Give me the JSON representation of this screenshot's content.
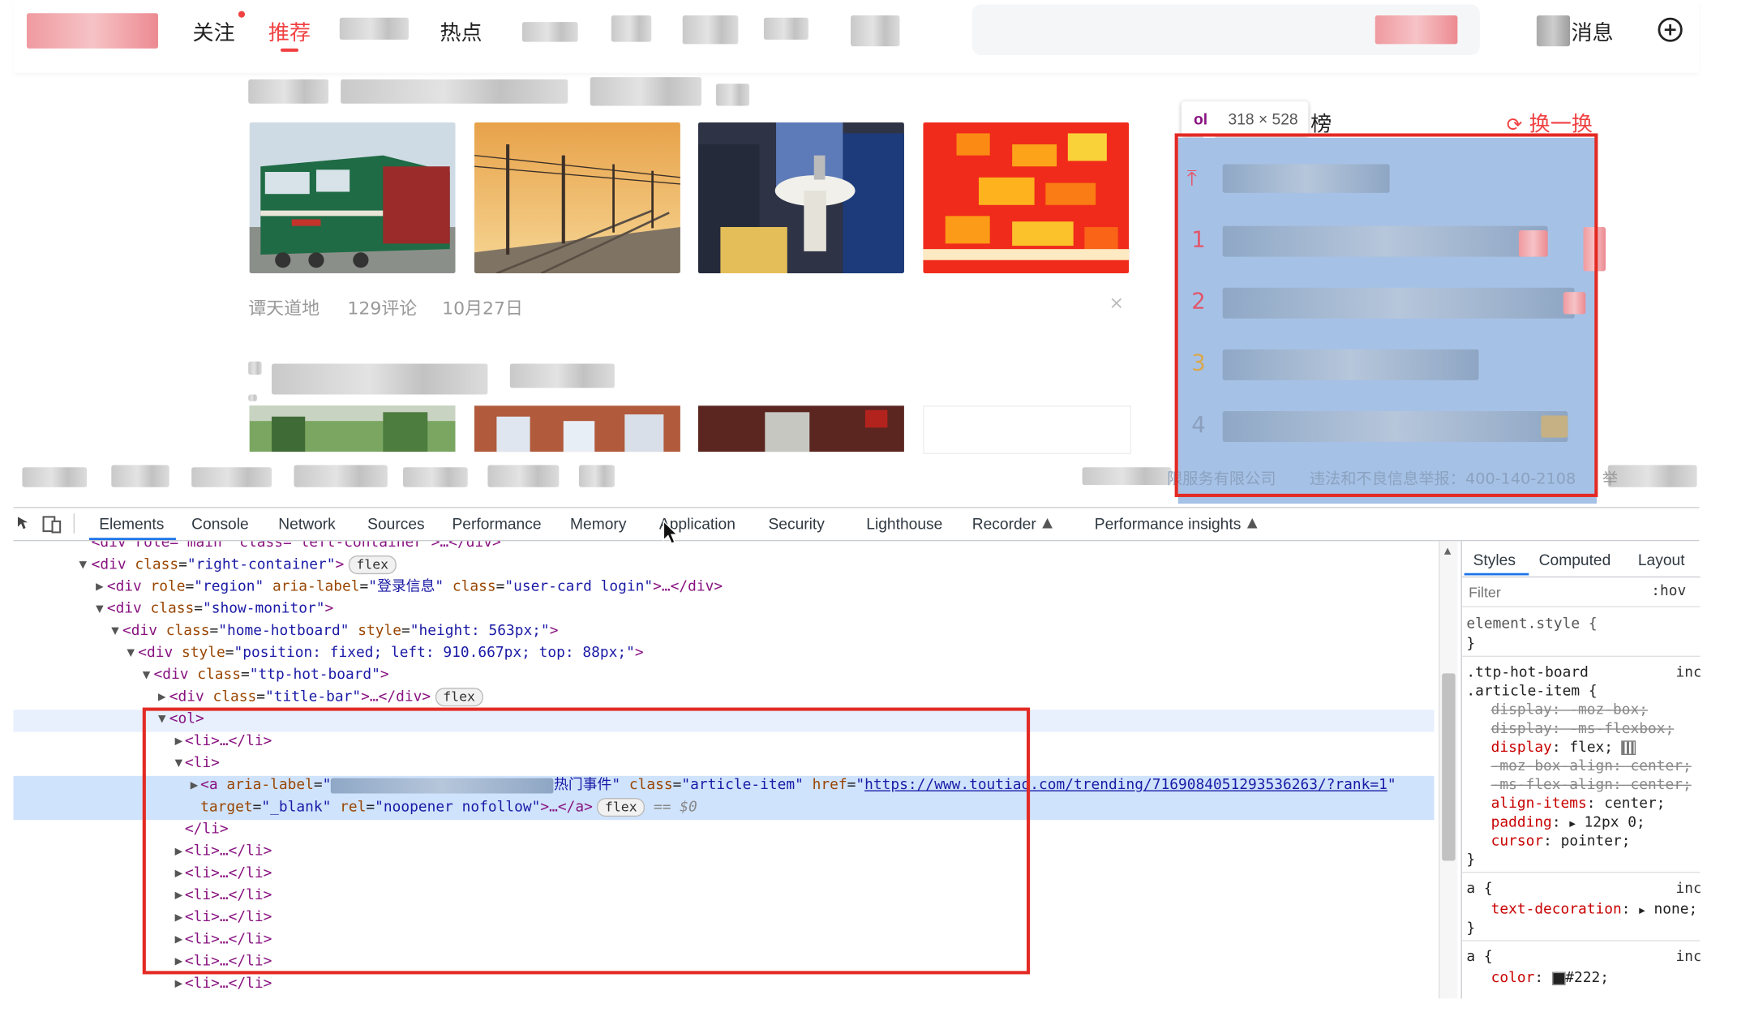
{
  "nav": {
    "follow": "关注",
    "recommend": "推荐",
    "hot": "热点",
    "messages": "消息"
  },
  "feed": {
    "article1": {
      "source": "谭天道地",
      "comments": "129评论",
      "date": "10月27日",
      "close_glyph": "×"
    }
  },
  "hotboard": {
    "inspect_tag": "ol",
    "inspect_size": "318 × 528",
    "title_tail": "榜",
    "refresh": "换一换",
    "pin_glyph": "⤒",
    "ranks": [
      "1",
      "2",
      "3",
      "4"
    ],
    "footer_left": "限服务有限公司",
    "footer_right": "违法和不良信息举报：400-140-2108",
    "footer_report": "举"
  },
  "devtools": {
    "tabs": [
      "Elements",
      "Console",
      "Network",
      "Sources",
      "Performance",
      "Memory",
      "Application",
      "Security",
      "Lighthouse",
      "Recorder",
      "Performance insights"
    ],
    "sidebar_tabs": [
      "Styles",
      "Computed",
      "Layout"
    ],
    "filter_placeholder": "Filter",
    "hov": ":hov",
    "dom": {
      "l0": "<div role=\"main\" class=\"left-container\">…</div>",
      "l1_tag": "<div",
      "l1_attr": "class",
      "l1_val": "\"right-container\"",
      "l1_end": ">",
      "l2_open": "<div",
      "l2_role": "role",
      "l2_role_val": "\"region\"",
      "l2_aria": "aria-label",
      "l2_aria_val": "\"登录信息\"",
      "l2_class": "class",
      "l2_class_val": "\"user-card login\"",
      "l2_end": ">…</div>",
      "l3_tag": "<div",
      "l3_attr": "class",
      "l3_val": "\"show-monitor\"",
      "l3_end": ">",
      "l4_tag": "<div",
      "l4_attr": "class",
      "l4_val": "\"home-hotboard\"",
      "l4_style": "style",
      "l4_style_val": "\"height: 563px;\"",
      "l4_end": ">",
      "l5_tag": "<div",
      "l5_style": "style",
      "l5_style_val": "\"position: fixed; left: 910.667px; top: 88px;\"",
      "l5_end": ">",
      "l6_tag": "<div",
      "l6_attr": "class",
      "l6_val": "\"ttp-hot-board\"",
      "l6_end": ">",
      "l7_tag": "<div",
      "l7_attr": "class",
      "l7_val": "\"title-bar\"",
      "l7_end": ">…</div>",
      "ol": "<ol>",
      "li_collapsed": "<li>…</li>",
      "li_open": "<li>",
      "a_tag": "<a",
      "a_aria": "aria-label",
      "a_aria_val_start": "\"",
      "a_aria_val_end": "热门事件\"",
      "a_class": "class",
      "a_class_val": "\"article-item\"",
      "a_href": "href",
      "a_href_val": "\"",
      "a_url": "https://www.toutiao.com/trending/7169084051293536263/?rank=1",
      "a_href_close": "\"",
      "a_target": "target",
      "a_target_val": "\"_blank\"",
      "a_rel": "rel",
      "a_rel_val": "\"noopener nofollow\"",
      "a_end": ">…</a>",
      "dollar": "== $0",
      "li_close": "</li>",
      "flex": "flex"
    },
    "styles": {
      "element_style": "element.style {",
      "close": "}",
      "sel1a": ".ttp-hot-board",
      "sel1b": ".article-item {",
      "inc": "inc",
      "d1": "display: -moz-box;",
      "d2": "display: -ms-flexbox;",
      "d3_p": "display",
      "d3_v": "flex;",
      "d4": "-moz-box-align: center;",
      "d5": "-ms-flex-align: center;",
      "d6_p": "align-items",
      "d6_v": "center;",
      "d7_p": "padding",
      "d7_v": "12px 0;",
      "d8_p": "cursor",
      "d8_v": "pointer;",
      "sel2": "a {",
      "d9_p": "text-decoration",
      "d9_v": "none;",
      "sel3": "a {",
      "d10_p": "color",
      "d10_v": "#222;"
    }
  }
}
